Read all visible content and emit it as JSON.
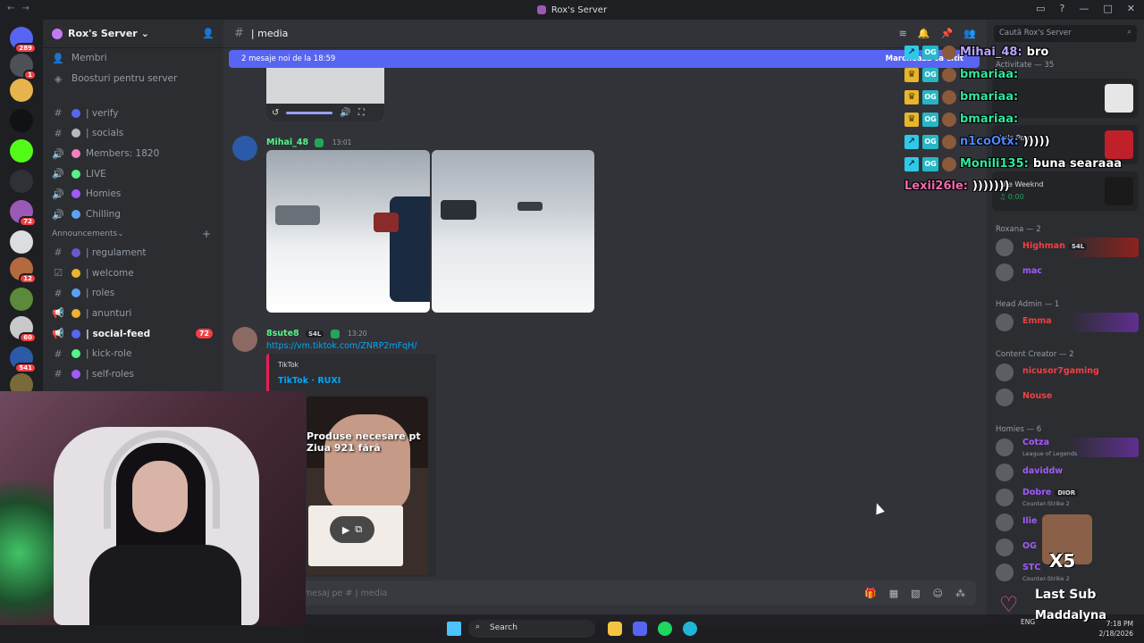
{
  "window": {
    "title": "Rox's Server"
  },
  "guilds": [
    {
      "name": "discord-home",
      "badge": "289",
      "color": "#5865f2"
    },
    {
      "name": "server-2",
      "badge": "1",
      "color": "#4e5058"
    },
    {
      "name": "server-3",
      "badge": "",
      "color": "#e6b34d"
    },
    {
      "name": "server-w",
      "badge": "",
      "color": "#111214"
    },
    {
      "name": "server-kick",
      "badge": "",
      "color": "#53fc18"
    },
    {
      "name": "server-6",
      "badge": "",
      "color": "#2f3136"
    },
    {
      "name": "rox-server",
      "badge": "72",
      "color": "#9b59b6"
    },
    {
      "name": "server-8",
      "badge": "",
      "color": "#dbdee1"
    },
    {
      "name": "server-9",
      "badge": "12",
      "color": "#b36a3f"
    },
    {
      "name": "server-10",
      "badge": "",
      "color": "#5a8a3a"
    },
    {
      "name": "server-11",
      "badge": "60",
      "color": "#c9c9c9"
    },
    {
      "name": "server-12",
      "badge": "541",
      "color": "#2d5aa8"
    },
    {
      "name": "server-13",
      "badge": "",
      "color": "#7a6a3a"
    }
  ],
  "sidebar": {
    "server_name": "Rox's Server",
    "top_items": [
      {
        "icon": "members-icon",
        "label": "Membri"
      },
      {
        "icon": "boost-icon",
        "label": "Boosturi pentru server"
      }
    ],
    "channels": [
      {
        "kind": "text",
        "emoji": "#5865f2",
        "label": "| verify"
      },
      {
        "kind": "text",
        "emoji": "#b5bac1",
        "label": "| socials"
      },
      {
        "kind": "voice",
        "emoji": "#f47fbf",
        "label": "Members: 1820"
      },
      {
        "kind": "voice",
        "emoji": "#57f287",
        "label": "LIVE"
      },
      {
        "kind": "voice",
        "emoji": "#a259ff",
        "label": "Homies"
      },
      {
        "kind": "voice",
        "emoji": "#5aa3f4",
        "label": "Chilling"
      }
    ],
    "category": "Announcements",
    "announcement_channels": [
      {
        "kind": "text",
        "emoji": "#6a5acd",
        "label": "| regulament",
        "count": ""
      },
      {
        "kind": "rules",
        "emoji": "#f0b232",
        "label": "| welcome",
        "count": ""
      },
      {
        "kind": "text",
        "emoji": "#5aa3f4",
        "label": "| roles",
        "count": ""
      },
      {
        "kind": "announce",
        "emoji": "#f0b232",
        "label": "| anunturi",
        "count": ""
      },
      {
        "kind": "announce",
        "emoji": "#5865f2",
        "label": "| social-feed",
        "count": "72",
        "active": true
      },
      {
        "kind": "text",
        "emoji": "#57f287",
        "label": "| kick-role",
        "count": ""
      },
      {
        "kind": "text",
        "emoji": "#a259ff",
        "label": "| self-roles",
        "count": ""
      }
    ]
  },
  "channel_header": {
    "name": "| media",
    "search_placeholder": "Caută Rox's Server"
  },
  "new_messages_bar": {
    "text": "2 mesaje noi de la 18:59",
    "action": "Marchează ca citit"
  },
  "messages": [
    {
      "author": "Mihai_48",
      "time": "13:01",
      "author_color": "#57f287"
    },
    {
      "author": "8sute8",
      "tag": "S4L",
      "time": "13:20",
      "author_color": "#57f287",
      "link": "https://vm.tiktok.com/ZNRP2mFqH/",
      "embed": {
        "provider": "TikTok",
        "title": "TikTok · RUXI",
        "caption": "Produse necesare pt Ziua 921 fără"
      }
    }
  ],
  "composer": {
    "placeholder": "mesaj pe # | media"
  },
  "members": {
    "activity_header": "Activitate — 35",
    "activity_cards": [
      {
        "line1": "",
        "line2": "",
        "color": "#e6e6e6"
      },
      {
        "line1": "Lele Pons",
        "line2": "",
        "color": "#c0202a"
      },
      {
        "line1": "The Weeknd",
        "line2": "♫ 0:00",
        "color": "#1a1a1a"
      }
    ],
    "groups": [
      {
        "title": "Roxana — 2",
        "members": [
          {
            "name": "Highman",
            "tag": "S4L",
            "activity": "",
            "color": "#f23f43",
            "plate": "#a0201a"
          },
          {
            "name": "mac",
            "activity": "",
            "color": "#a259ff",
            "plate": ""
          }
        ]
      },
      {
        "title": "Head Admin — 1",
        "members": [
          {
            "name": "Emma",
            "activity": "",
            "color": "#f23f43",
            "plate": "#6a2fa0"
          }
        ]
      },
      {
        "title": "Content Creator — 2",
        "members": [
          {
            "name": "nicusor7gaming",
            "activity": "",
            "color": "#f23f43",
            "plate": ""
          },
          {
            "name": "Nouse",
            "activity": "",
            "color": "#f23f43",
            "plate": ""
          }
        ]
      },
      {
        "title": "Homies — 6",
        "members": [
          {
            "name": "Cotza",
            "activity": "League of Legends",
            "color": "#a259ff",
            "plate": "#6a2fa0"
          },
          {
            "name": "daviddw",
            "activity": "",
            "color": "#a259ff",
            "plate": ""
          },
          {
            "name": "Dobre",
            "tag": "DIOR",
            "activity": "Counter-Strike 2",
            "color": "#a259ff",
            "plate": ""
          },
          {
            "name": "Ilie",
            "activity": "",
            "color": "#a259ff",
            "plate": ""
          },
          {
            "name": "OG",
            "activity": "",
            "color": "#a259ff",
            "plate": ""
          },
          {
            "name": "STC",
            "activity": "Counter-Strike 2",
            "color": "#a259ff",
            "plate": ""
          }
        ]
      }
    ]
  },
  "stream_chat": [
    {
      "badges": [
        "blue",
        "OG"
      ],
      "user": "Mihai_48:",
      "user_color": "#b9a6ff",
      "text": "bro"
    },
    {
      "badges": [
        "gold",
        "OG"
      ],
      "user": "bmariaa:",
      "user_color": "#2ee6a0",
      "text": ""
    },
    {
      "badges": [
        "gold",
        "OG"
      ],
      "user": "bmariaa:",
      "user_color": "#2ee6a0",
      "text": ""
    },
    {
      "badges": [
        "gold",
        "OG"
      ],
      "user": "bmariaa:",
      "user_color": "#2ee6a0",
      "text": ""
    },
    {
      "badges": [
        "blue",
        "OG"
      ],
      "user": "n1coOtx:",
      "user_color": "#4f86ff",
      "text": ")))))"
    },
    {
      "badges": [
        "blue",
        "OG"
      ],
      "user": "Monili135:",
      "user_color": "#2ee6a0",
      "text": "buna searaaa"
    },
    {
      "badges": [],
      "user": "Lexii26le:",
      "user_color": "#f26ab1",
      "text": ")))))))"
    }
  ],
  "overlay": {
    "multiplier": "X5",
    "last_sub_label": "Last Sub",
    "last_sub_name": "Maddalyna"
  },
  "taskbar": {
    "search": "Search",
    "lang": "ENG",
    "time": "7:18 PM",
    "date": "2/18/2026"
  }
}
